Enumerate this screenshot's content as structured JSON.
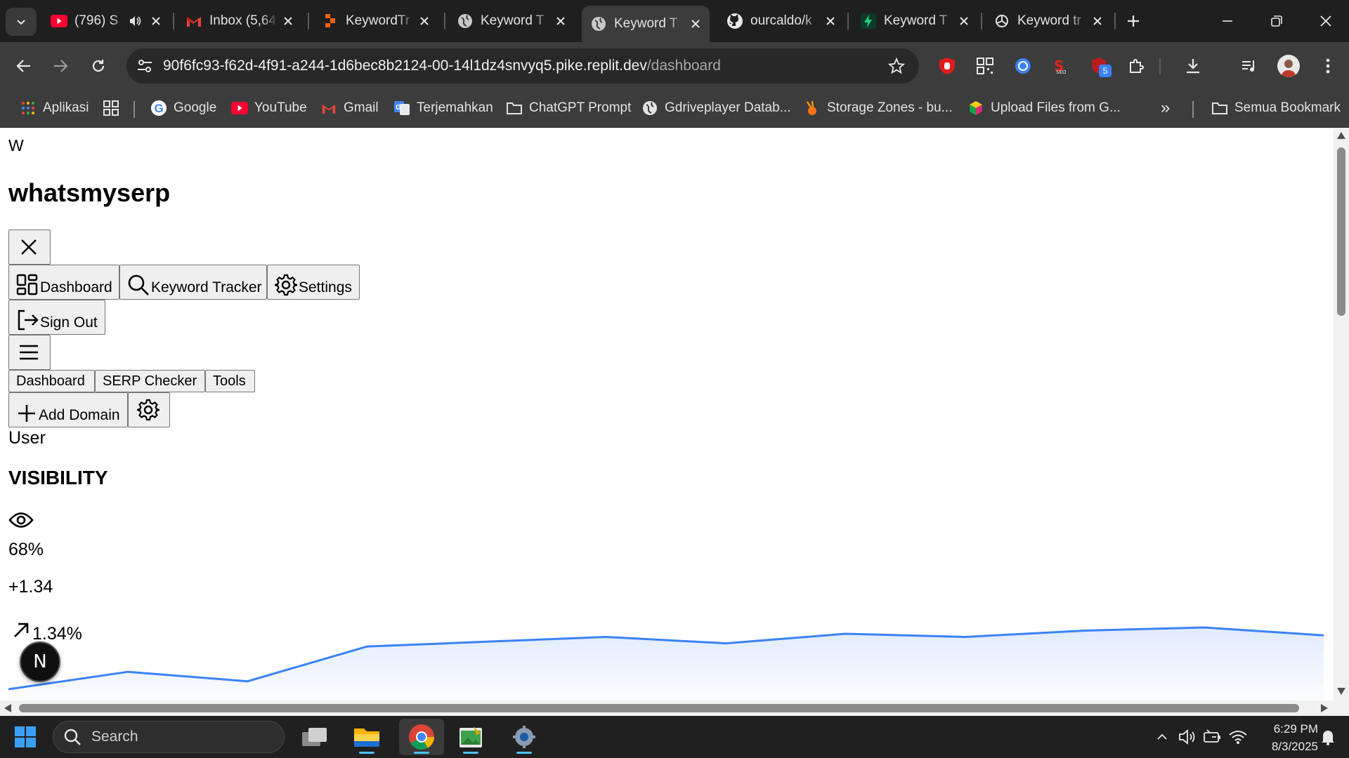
{
  "browser": {
    "tabs": [
      {
        "title": "(796) S",
        "favicon": "youtube-icon"
      },
      {
        "title": "Inbox (5,64",
        "favicon": "gmail-icon"
      },
      {
        "title": "KeywordTr",
        "favicon": "replit-icon"
      },
      {
        "title": "Keyword T",
        "favicon": "globe-icon"
      },
      {
        "title": "Keyword T",
        "favicon": "globe-icon",
        "active": true
      },
      {
        "title": "ourcaldo/k",
        "favicon": "github-icon"
      },
      {
        "title": "Keyword T",
        "favicon": "bolt-icon"
      },
      {
        "title": "Keyword tr",
        "favicon": "openai-icon"
      }
    ],
    "url_host": "90f6fc93-f62d-4f91-a244-1d6bec8b2124-00-14l1dz4snvyq5.pike.replit.dev",
    "url_path": "/dashboard",
    "extension_badge": "5",
    "bookmarks": [
      {
        "label": "Aplikasi",
        "icon": "apps-grid-icon"
      },
      {
        "label": "Google",
        "icon": "google-icon"
      },
      {
        "label": "YouTube",
        "icon": "youtube-icon"
      },
      {
        "label": "Gmail",
        "icon": "gmail-icon"
      },
      {
        "label": "Terjemahkan",
        "icon": "translate-icon"
      },
      {
        "label": "ChatGPT Prompt",
        "icon": "folder-icon"
      },
      {
        "label": "Gdriveplayer Datab...",
        "icon": "globe-icon"
      },
      {
        "label": "Storage Zones - bu...",
        "icon": "bunny-icon"
      },
      {
        "label": "Upload Files from G...",
        "icon": "cube-icon"
      }
    ],
    "all_bookmarks": "Semua Bookmark",
    "more_chevron": "»"
  },
  "page": {
    "logo_letter": "W",
    "brand": "whatsmyserp",
    "nav": {
      "dashboard": "Dashboard",
      "keyword_tracker": "Keyword Tracker",
      "settings": "Settings",
      "sign_out": "Sign Out"
    },
    "tabs": [
      "Dashboard",
      "SERP Checker",
      "Tools"
    ],
    "add_domain": "Add Domain",
    "user_label": "User",
    "visibility": {
      "heading": "VISIBILITY",
      "value": "68%",
      "delta": "+1.34",
      "change": "1.34%"
    },
    "sparkline": {
      "color": "#3b82f6",
      "values": [
        0.0,
        1.1,
        0.5,
        2.7,
        3.0,
        3.3,
        2.9,
        3.5,
        3.3,
        3.7,
        3.9,
        3.4
      ]
    },
    "floating_badge": "N"
  },
  "taskbar": {
    "search_placeholder": "Search",
    "time": "6:29 PM",
    "date": "8/3/2025"
  }
}
